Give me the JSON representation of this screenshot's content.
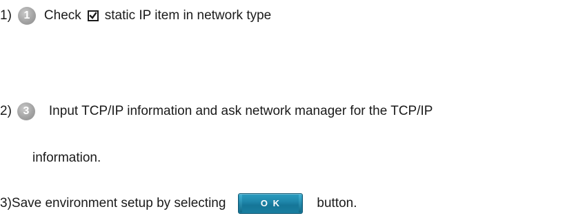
{
  "steps": [
    {
      "prefix": "1)",
      "badge": "1",
      "text_before": "Check",
      "text_after": "static IP item in network type"
    },
    {
      "prefix": "2)",
      "badge": "3",
      "text": "Input TCP/IP information and ask network manager for the TCP/IP",
      "continuation": "information."
    },
    {
      "prefix": "3)",
      "text": "Save environment setup by selecting",
      "button_label": "O K",
      "text_after": "button."
    }
  ],
  "colors": {
    "text": "#1a1a1a",
    "badge": "#a3a3a3",
    "ok_button": "#1f86aa"
  },
  "icons": {
    "checkbox": "checked-checkbox-icon",
    "badge": "numbered-circle-icon"
  }
}
